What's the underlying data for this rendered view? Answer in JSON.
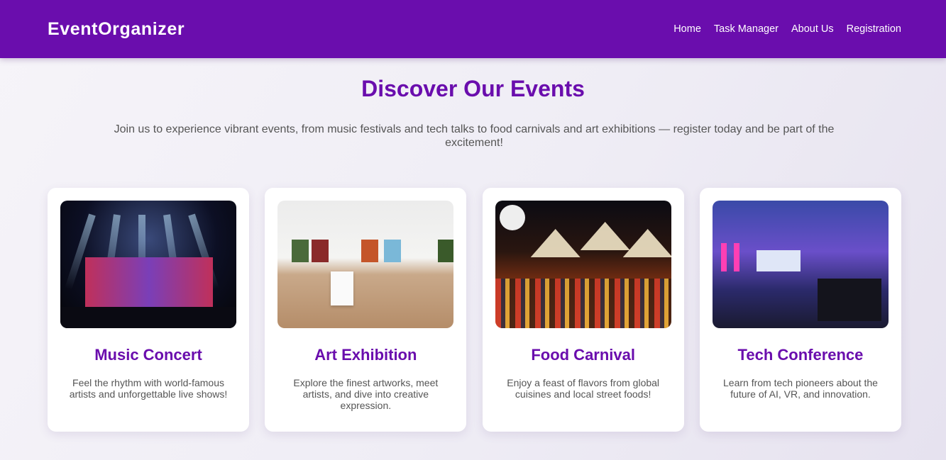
{
  "header": {
    "brand": "EventOrganizer",
    "nav": [
      {
        "label": "Home"
      },
      {
        "label": "Task Manager"
      },
      {
        "label": "About Us"
      },
      {
        "label": "Registration"
      }
    ]
  },
  "hero": {
    "title": "Discover Our Events",
    "subtitle": "Join us to experience vibrant events, from music festivals and tech talks to food carnivals and art exhibitions — register today and be part of the excitement!"
  },
  "events": [
    {
      "title": "Music Concert",
      "description": "Feel the rhythm with world-famous artists and unforgettable live shows!",
      "image": "concert-stage-image"
    },
    {
      "title": "Art Exhibition",
      "description": "Explore the finest artworks, meet artists, and dive into creative expression.",
      "image": "art-gallery-image"
    },
    {
      "title": "Food Carnival",
      "description": "Enjoy a feast of flavors from global cuisines and local street foods!",
      "image": "night-food-market-image"
    },
    {
      "title": "Tech Conference",
      "description": "Learn from tech pioneers about the future of AI, VR, and innovation.",
      "image": "tech-conference-hall-image"
    }
  ],
  "colors": {
    "primary": "#6a0dad",
    "background": "#efedf5",
    "card": "#ffffff",
    "text": "#555555"
  }
}
